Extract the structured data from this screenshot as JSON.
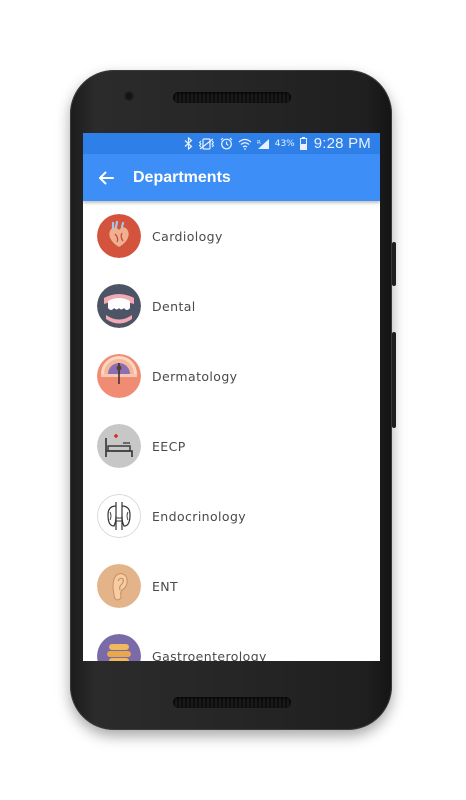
{
  "status_bar": {
    "battery_percent": "43%",
    "time": "9:28 PM",
    "icons": [
      "bluetooth-icon",
      "vibrate-icon",
      "alarm-icon",
      "wifi-icon",
      "signal-icon",
      "battery-icon"
    ]
  },
  "app_bar": {
    "back_icon": "arrow-left-icon",
    "title": "Departments"
  },
  "colors": {
    "status_bar": "#2f7fe8",
    "app_bar": "#3d8ef6"
  },
  "departments": [
    {
      "label": "Cardiology",
      "icon": "heart-icon"
    },
    {
      "label": "Dental",
      "icon": "tooth-icon"
    },
    {
      "label": "Dermatology",
      "icon": "skin-layer-icon"
    },
    {
      "label": "EECP",
      "icon": "hospital-bed-icon"
    },
    {
      "label": "Endocrinology",
      "icon": "thyroid-icon"
    },
    {
      "label": "ENT",
      "icon": "ear-icon"
    },
    {
      "label": "Gastroenterology",
      "icon": "intestine-icon"
    }
  ]
}
